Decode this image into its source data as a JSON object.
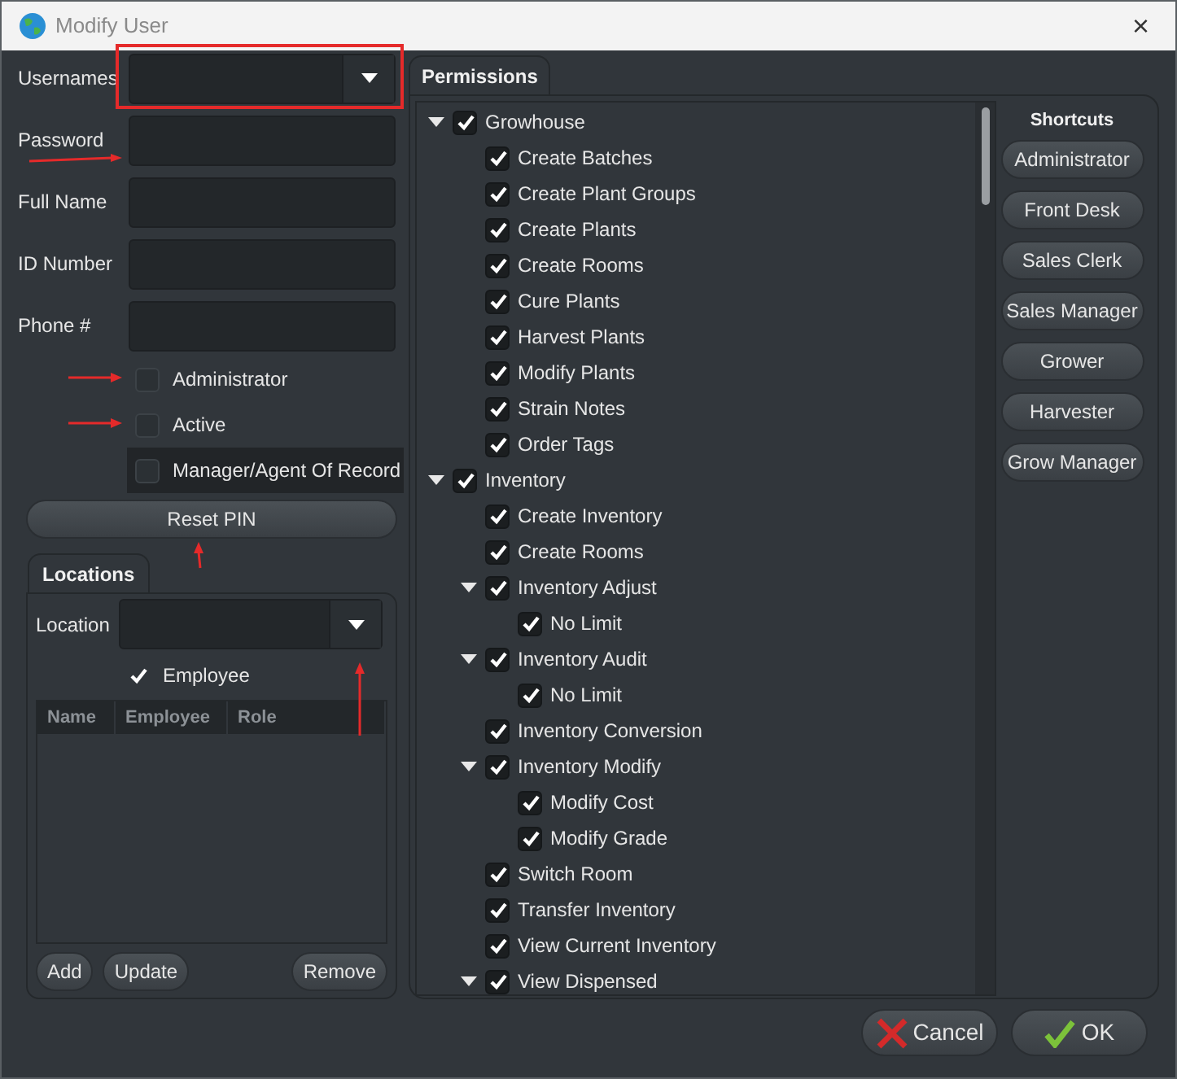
{
  "window": {
    "title": "Modify User",
    "close": "×"
  },
  "user_form": {
    "fields": [
      {
        "label": "Usernames",
        "kind": "dropdown"
      },
      {
        "label": "Password",
        "kind": "text"
      },
      {
        "label": "Full Name",
        "kind": "text"
      },
      {
        "label": "ID Number",
        "kind": "text"
      },
      {
        "label": "Phone #",
        "kind": "text"
      }
    ],
    "checkboxes": [
      {
        "label": "Administrator",
        "checked": false,
        "focused": false
      },
      {
        "label": "Active",
        "checked": false,
        "focused": false
      },
      {
        "label": "Manager/Agent Of Record",
        "checked": false,
        "focused": true
      }
    ],
    "reset_button": "Reset PIN"
  },
  "locations": {
    "tab": "Locations",
    "location_label": "Location",
    "employee": {
      "label": "Employee",
      "checked": true
    },
    "table": {
      "columns": [
        "Name",
        "Employee",
        "Role"
      ]
    },
    "buttons": [
      "Add",
      "Update",
      "Remove"
    ]
  },
  "permissions": {
    "tab": "Permissions",
    "tree": [
      {
        "label": "Growhouse",
        "checked": true,
        "expanded": true,
        "children": [
          {
            "label": "Create Batches",
            "checked": true
          },
          {
            "label": "Create Plant Groups",
            "checked": true
          },
          {
            "label": "Create Plants",
            "checked": true
          },
          {
            "label": "Create Rooms",
            "checked": true
          },
          {
            "label": "Cure Plants",
            "checked": true
          },
          {
            "label": "Harvest Plants",
            "checked": true
          },
          {
            "label": "Modify Plants",
            "checked": true
          },
          {
            "label": "Strain Notes",
            "checked": true
          },
          {
            "label": "Order Tags",
            "checked": true
          }
        ]
      },
      {
        "label": "Inventory",
        "checked": true,
        "expanded": true,
        "children": [
          {
            "label": "Create Inventory",
            "checked": true
          },
          {
            "label": "Create Rooms",
            "checked": true
          },
          {
            "label": "Inventory Adjust",
            "checked": true,
            "expanded": true,
            "children": [
              {
                "label": "No Limit",
                "checked": true
              }
            ]
          },
          {
            "label": "Inventory Audit",
            "checked": true,
            "expanded": true,
            "children": [
              {
                "label": "No Limit",
                "checked": true
              }
            ]
          },
          {
            "label": "Inventory Conversion",
            "checked": true
          },
          {
            "label": "Inventory Modify",
            "checked": true,
            "expanded": true,
            "children": [
              {
                "label": "Modify Cost",
                "checked": true
              },
              {
                "label": "Modify Grade",
                "checked": true
              }
            ]
          },
          {
            "label": "Switch Room",
            "checked": true
          },
          {
            "label": "Transfer Inventory",
            "checked": true
          },
          {
            "label": "View Current Inventory",
            "checked": true
          },
          {
            "label": "View Dispensed",
            "checked": true,
            "expanded": true
          }
        ]
      }
    ]
  },
  "shortcuts": {
    "title": "Shortcuts",
    "buttons": [
      "Administrator",
      "Front Desk",
      "Sales Clerk",
      "Sales Manager",
      "Grower",
      "Harvester",
      "Grow Manager"
    ]
  },
  "buttons": [
    {
      "label": "Cancel",
      "kind": "cancel"
    },
    {
      "label": "OK",
      "kind": "ok"
    }
  ]
}
